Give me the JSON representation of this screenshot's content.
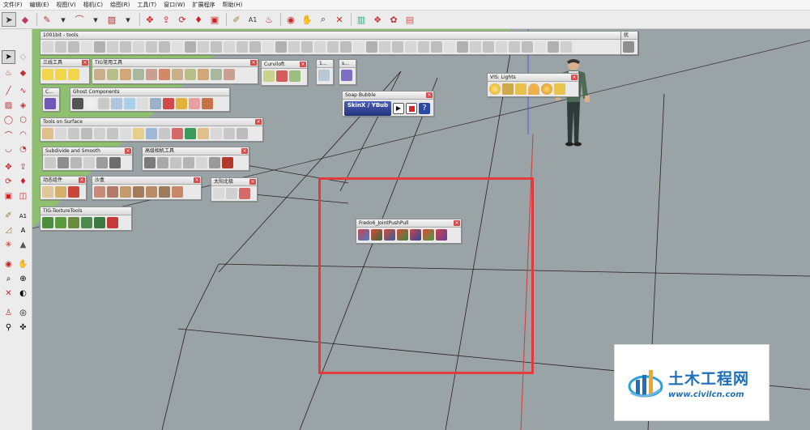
{
  "menu": [
    "文件(F)",
    "编辑(E)",
    "视图(V)",
    "相机(C)",
    "绘图(R)",
    "工具(T)",
    "窗口(W)",
    "扩展程序",
    "帮助(H)"
  ],
  "toolbars": {
    "t1001bit": "1001bit - tools",
    "sanxian": "三线工具",
    "tig_common": "TIG常用工具",
    "curviloft": "Curviloft",
    "small1": "1...",
    "small2": "s...",
    "c_box": "C...",
    "ghost": "Ghost Components",
    "tools_on_surface": "Tools on Surface",
    "subdivide": "Subdivide and Smooth",
    "gaoji": "高级相机工具",
    "dongtai": "动态组件",
    "shapan": "沙盒",
    "taiyang": "太阳北极",
    "texture": "TIG-TextureTools",
    "soap": "Soap Bubble",
    "soap_label": "SkinX / YBub",
    "vis": "VIS: Lights",
    "fredo": "Fredo6_JointPushPull",
    "right_panel": "扰",
    "close_glyph": "×"
  },
  "watermark": {
    "title": "土木工程网",
    "url": "www.civilcn.com"
  },
  "colors": {
    "viewport": "#9aa3a6",
    "ground_green": "#8fc06f",
    "highlight": "#e23b3b",
    "brand": "#1f6fb8"
  }
}
